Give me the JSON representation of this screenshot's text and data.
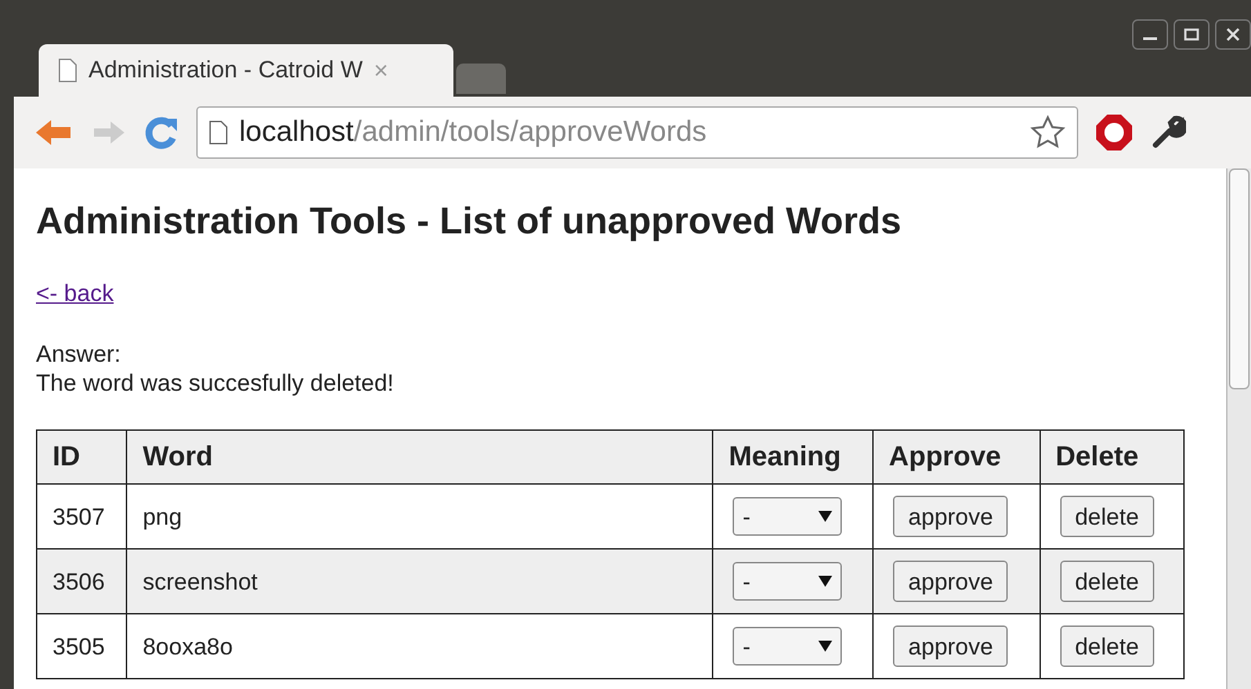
{
  "tabs": [
    {
      "title": "Administration - Catroid W",
      "close": "×",
      "selected": true
    },
    {
      "selected": false
    }
  ],
  "address_bar": {
    "host": "localhost",
    "path": "/admin/tools/approveWords"
  },
  "page": {
    "heading": "Administration Tools - List of unapproved Words",
    "back_link": "<- back",
    "answer_label": "Answer:",
    "answer_message": "The word was succesfully deleted!"
  },
  "table": {
    "columns": [
      "ID",
      "Word",
      "Meaning",
      "Approve",
      "Delete"
    ],
    "rows": [
      {
        "id": "3507",
        "word": "png",
        "meaning": "-",
        "approve": "approve",
        "delete": "delete"
      },
      {
        "id": "3506",
        "word": "screenshot",
        "meaning": "-",
        "approve": "approve",
        "delete": "delete"
      },
      {
        "id": "3505",
        "word": "8ooxa8o",
        "meaning": "-",
        "approve": "approve",
        "delete": "delete"
      }
    ]
  }
}
